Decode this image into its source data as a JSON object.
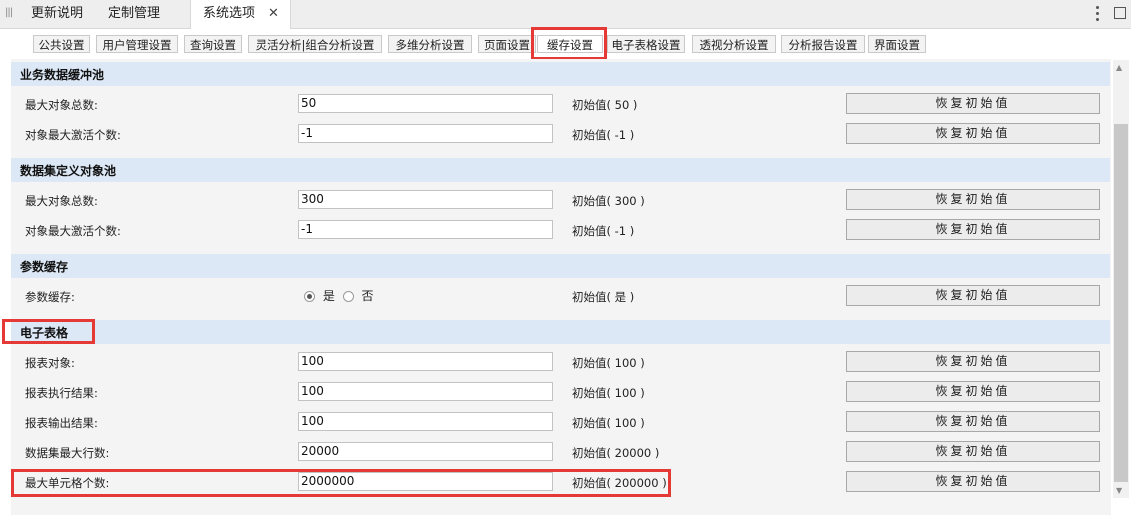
{
  "top_tabs": [
    {
      "label": "更新说明"
    },
    {
      "label": "定制管理"
    },
    {
      "label": "系统选项",
      "active": true,
      "close": "✕"
    }
  ],
  "sub_tabs": [
    "公共设置",
    "用户管理设置",
    "查询设置",
    "灵活分析|组合分析设置",
    "多维分析设置",
    "页面设置",
    "缓存设置",
    "电子表格设置",
    "透视分析设置",
    "分析报告设置",
    "界面设置"
  ],
  "active_sub_tab": "缓存设置",
  "sections": {
    "s1": {
      "title": "业务数据缓冲池",
      "rows": [
        {
          "label": "最大对象总数:",
          "value": "50",
          "init": "初始值( 50 )",
          "btn": "恢复初始值"
        },
        {
          "label": "对象最大激活个数:",
          "value": "-1",
          "init": "初始值( -1 )",
          "btn": "恢复初始值"
        }
      ]
    },
    "s2": {
      "title": "数据集定义对象池",
      "rows": [
        {
          "label": "最大对象总数:",
          "value": "300",
          "init": "初始值( 300 )",
          "btn": "恢复初始值"
        },
        {
          "label": "对象最大激活个数:",
          "value": "-1",
          "init": "初始值( -1 )",
          "btn": "恢复初始值"
        }
      ]
    },
    "s3": {
      "title": "参数缓存",
      "rows": [
        {
          "label": "参数缓存:",
          "yes": "是",
          "no": "否",
          "selected": "是",
          "init": "初始值( 是 )",
          "btn": "恢复初始值"
        }
      ]
    },
    "s4": {
      "title": "电子表格",
      "rows": [
        {
          "label": "报表对象:",
          "value": "100",
          "init": "初始值( 100 )",
          "btn": "恢复初始值"
        },
        {
          "label": "报表执行结果:",
          "value": "100",
          "init": "初始值( 100 )",
          "btn": "恢复初始值"
        },
        {
          "label": "报表输出结果:",
          "value": "100",
          "init": "初始值( 100 )",
          "btn": "恢复初始值"
        },
        {
          "label": "数据集最大行数:",
          "value": "20000",
          "init": "初始值( 20000 )",
          "btn": "恢复初始值"
        },
        {
          "label": "最大单元格个数:",
          "value": "2000000",
          "init": "初始值( 200000 )",
          "btn": "恢复初始值"
        }
      ]
    }
  },
  "colors": {
    "highlight": "#e53935",
    "section_bg": "#dce8f5",
    "content_bg": "#f4f4f4"
  },
  "icons": {
    "grip": "grip-icon",
    "close": "close-icon",
    "more": "more-vertical-icon",
    "maximize": "maximize-icon",
    "scroll_up": "scroll-up-icon",
    "scroll_down": "scroll-down-icon"
  }
}
